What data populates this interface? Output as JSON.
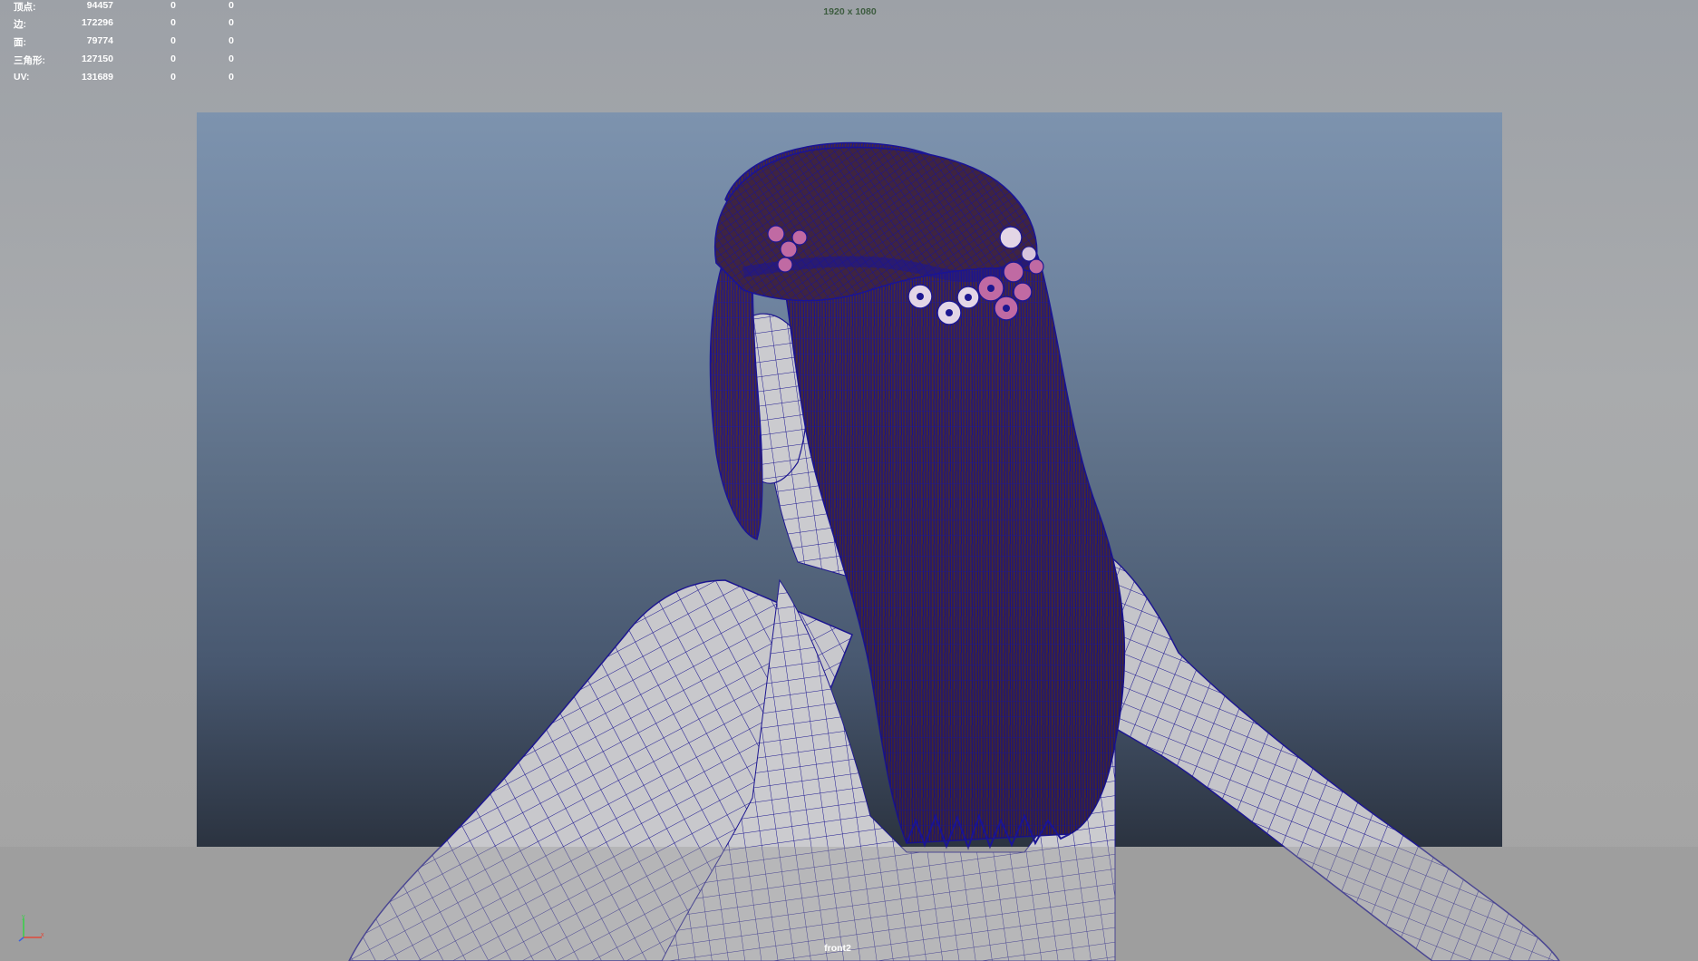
{
  "hud": {
    "rows": [
      {
        "label": "顶点:",
        "v1": "94457",
        "v2": "0",
        "v3": "0"
      },
      {
        "label": "边:",
        "v1": "172296",
        "v2": "0",
        "v3": "0"
      },
      {
        "label": "面:",
        "v1": "79774",
        "v2": "0",
        "v3": "0"
      },
      {
        "label": "三角形:",
        "v1": "127150",
        "v2": "0",
        "v3": "0"
      },
      {
        "label": "UV:",
        "v1": "131689",
        "v2": "0",
        "v3": "0"
      }
    ]
  },
  "resolution": "1920 x 1080",
  "camera_name": "front2",
  "axis": {
    "y": "y",
    "x": "x"
  },
  "colors": {
    "wireframe": "#1d1790",
    "hair": "#4a2a3a",
    "skin": "#c9c9cd",
    "flower_pink": "#c06aa3",
    "flower_white": "#e3d6e6"
  }
}
